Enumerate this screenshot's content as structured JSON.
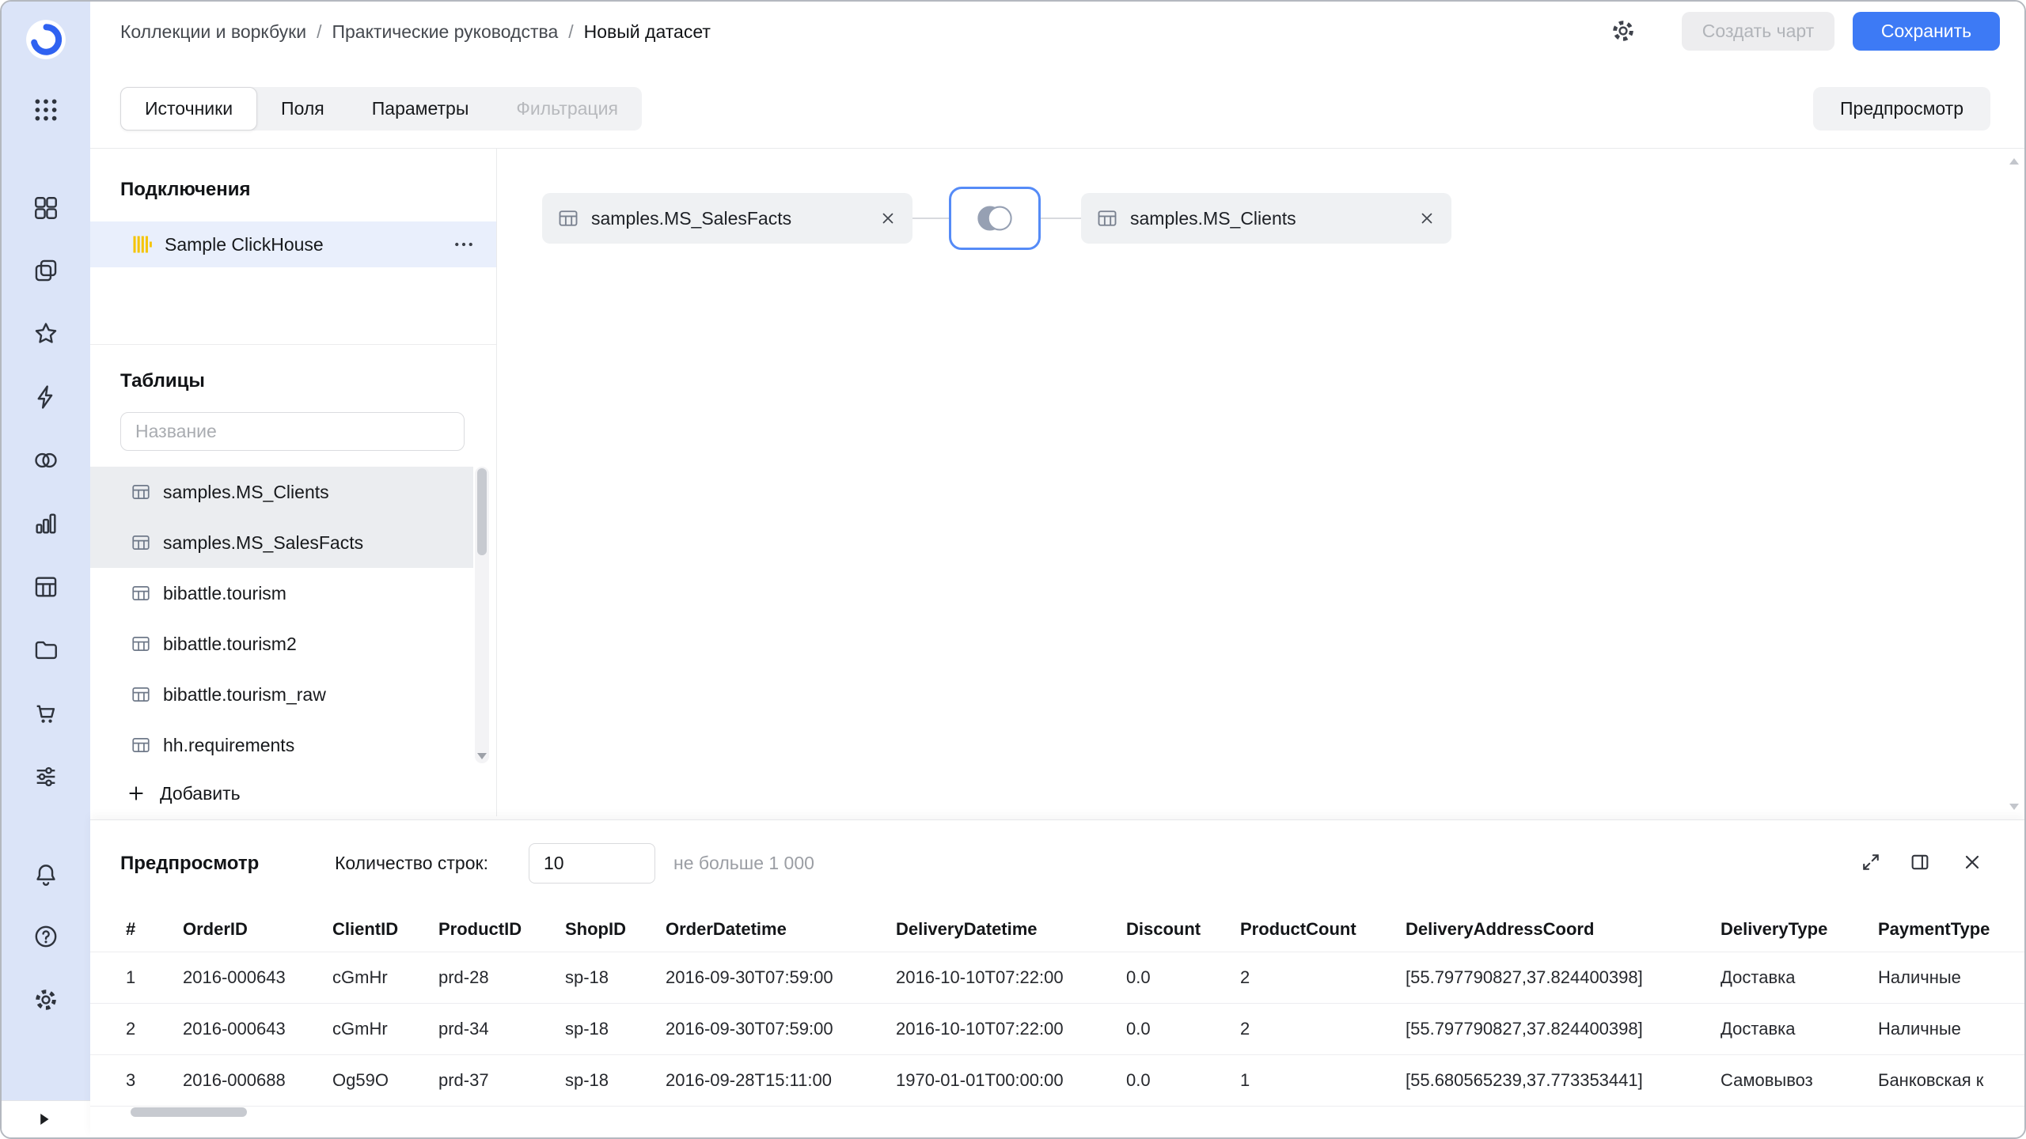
{
  "breadcrumb": {
    "items": [
      "Коллекции и воркбуки",
      "Практические руководства",
      "Новый датасет"
    ],
    "separator": "/"
  },
  "header_actions": {
    "create_chart": "Создать чарт",
    "save": "Сохранить"
  },
  "tabs": {
    "items": [
      {
        "label": "Источники",
        "state": "active"
      },
      {
        "label": "Поля",
        "state": "normal"
      },
      {
        "label": "Параметры",
        "state": "normal"
      },
      {
        "label": "Фильтрация",
        "state": "disabled"
      }
    ],
    "preview_button": "Предпросмотр"
  },
  "connections": {
    "title": "Подключения",
    "items": [
      {
        "name": "Sample ClickHouse",
        "type": "clickhouse",
        "selected": true
      }
    ]
  },
  "tables": {
    "title": "Таблицы",
    "search_placeholder": "Название",
    "items": [
      "samples.MS_Clients",
      "samples.MS_SalesFacts",
      "bibattle.tourism",
      "bibattle.tourism2",
      "bibattle.tourism_raw",
      "hh.requirements"
    ],
    "in_use": [
      "samples.MS_Clients",
      "samples.MS_SalesFacts"
    ],
    "add_label": "Добавить"
  },
  "canvas": {
    "sources": [
      "samples.MS_SalesFacts",
      "samples.MS_Clients"
    ],
    "join_type": "inner"
  },
  "preview": {
    "title": "Предпросмотр",
    "rows_label": "Количество строк:",
    "rows_value": "10",
    "rows_hint": "не больше 1 000",
    "columns": [
      "#",
      "OrderID",
      "ClientID",
      "ProductID",
      "ShopID",
      "OrderDatetime",
      "DeliveryDatetime",
      "Discount",
      "ProductCount",
      "DeliveryAddressCoord",
      "DeliveryType",
      "PaymentType"
    ],
    "rows": [
      [
        "1",
        "2016-000643",
        "cGmHr",
        "prd-28",
        "sp-18",
        "2016-09-30T07:59:00",
        "2016-10-10T07:22:00",
        "0.0",
        "2",
        "[55.797790827,37.824400398]",
        "Доставка",
        "Наличные"
      ],
      [
        "2",
        "2016-000643",
        "cGmHr",
        "prd-34",
        "sp-18",
        "2016-09-30T07:59:00",
        "2016-10-10T07:22:00",
        "0.0",
        "2",
        "[55.797790827,37.824400398]",
        "Доставка",
        "Наличные"
      ],
      [
        "3",
        "2016-000688",
        "Og59O",
        "prd-37",
        "sp-18",
        "2016-09-28T15:11:00",
        "1970-01-01T00:00:00",
        "0.0",
        "1",
        "[55.680565239,37.773353441]",
        "Самовывоз",
        "Банковская к"
      ]
    ]
  },
  "colors": {
    "accent_blue": "#3d7af5",
    "sidebar_bg": "#dbe4f8",
    "join_border": "#558bf7",
    "clickhouse_yellow": "#f5c400",
    "selected_connection_bg": "#e9effc"
  }
}
